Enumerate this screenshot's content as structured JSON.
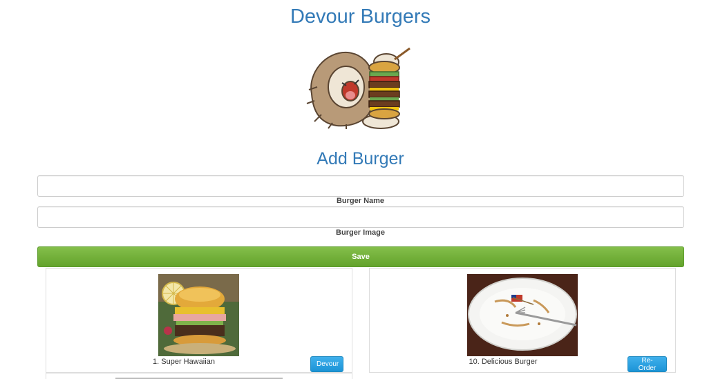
{
  "header": {
    "title": "Devour Burgers"
  },
  "form": {
    "heading": "Add Burger",
    "burger_name_label": "Burger Name",
    "burger_name_value": "",
    "burger_image_label": "Burger Image",
    "burger_image_value": "",
    "save_label": "Save"
  },
  "burgers": [
    {
      "label": "1. Super Hawaiian",
      "button": "Devour",
      "image": "hawaiian-burger-photo"
    },
    {
      "label": "10. Delicious Burger",
      "button": "Re-Order",
      "image": "empty-plate-photo"
    }
  ],
  "colors": {
    "heading": "#337ab7",
    "save": "#6aab34",
    "action": "#2a9fd6"
  }
}
